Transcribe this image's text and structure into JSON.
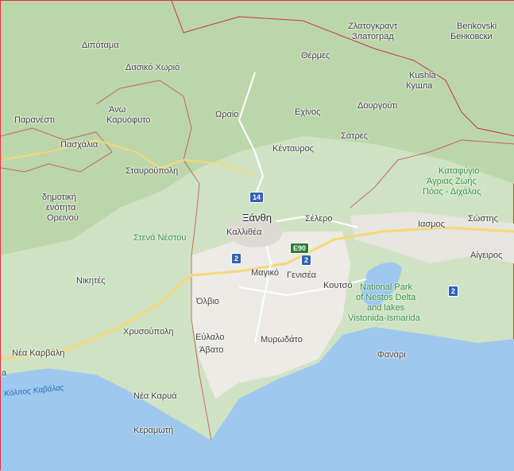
{
  "colors": {
    "land": "#cfe3c4",
    "mountain": "#b9d4a8",
    "plain": "#ecebe5",
    "sea": "#9ec8ee",
    "border": "#c2383a",
    "road": "#f7d77a",
    "park_label": "#2f8f3a"
  },
  "places": {
    "zlatograd_gr": "Ζλατογκραντ",
    "zlatograd_local": "Златоград",
    "benkovski_gr": "Benkovski",
    "benkovski_local": "Бенковски",
    "dipotama": "Διπόταμα",
    "dasiko_chorio": "Δασικό Χωριό",
    "thermes": "Θέρμες",
    "kushla_gr": "Kushla",
    "kushla_local": "Кушла",
    "parantesti": "Παρανέστι",
    "ano_karyofyto_1": "Άνω",
    "ano_karyofyto_2": "Καρυόφυτο",
    "oraio": "Ωραίο",
    "echinos": "Εχίνος",
    "dourgouti": "Δουργούτι",
    "paschalia": "Πασχάλια",
    "kentavros": "Κένταυρος",
    "satres": "Σάτρες",
    "stavroupoli": "Σταυρούπολη",
    "reserve_1": "Καταφύγιο",
    "reserve_2": "Άγριας Ζωής",
    "reserve_3": "Πόας - Διχάλας",
    "dim_1": "δημοτική",
    "dim_2": "ενότητα",
    "dim_3": "Ορεινού",
    "xanthi": "Ξάνθη",
    "selero": "Σέλερο",
    "sosti": "Σώστης",
    "kallithea": "Καλλιθέα",
    "iasmos": "Ιασμος",
    "stena_nestou": "Στενά Νέστου",
    "aigeiros": "Αίγειρος",
    "nikites": "Νικητές",
    "magiko": "Μαγικό",
    "genisea": "Γενισέα",
    "koutso": "Κουτσό",
    "park_1": "National Park",
    "park_2": "of Nestos Delta",
    "park_3": "and lakes",
    "park_4": "Vistonida-Ismarida",
    "olvio": "Όλβιο",
    "chrysoupoli": "Χρυσούπολη",
    "evlalo": "Εύλαλο",
    "avato": "Άβατο",
    "myrodato": "Μυρωδάτο",
    "fanari": "Φανάρι",
    "nea_karvali": "Νέα Καρβάλη",
    "gulf_kavala": "Κόλπος Καβάλας",
    "nea_karya": "Νέα Καρυά",
    "keramoti": "Κεραμωτή",
    "edge_a": "a"
  },
  "roads": {
    "r14": "14",
    "r2_west": "2",
    "r2_mid": "2",
    "r2_east": "2",
    "e90": "E90"
  }
}
